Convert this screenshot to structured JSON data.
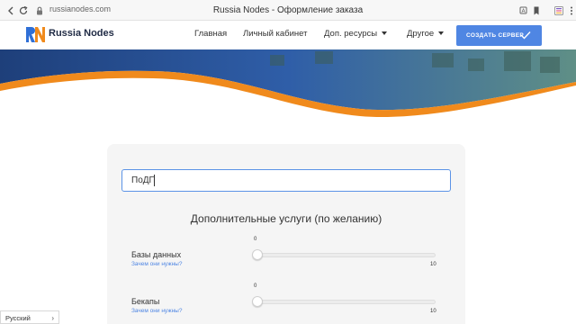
{
  "browser": {
    "url": "russianodes.com",
    "tab_title": "Russia Nodes - Оформление заказа"
  },
  "nav": {
    "brand": "Russia Nodes",
    "items": [
      {
        "label": "Главная",
        "dropdown": false
      },
      {
        "label": "Личный кабинет",
        "dropdown": false
      },
      {
        "label": "Доп. ресурсы",
        "dropdown": true
      },
      {
        "label": "Другое",
        "dropdown": true
      }
    ],
    "create_button": "СОЗДАТЬ СЕРВЕР"
  },
  "order": {
    "promo_value": "ПоДП",
    "section_title": "Дополнительные услуги (по желанию)",
    "options": [
      {
        "label": "Базы данных",
        "link": "Зачем они нужны?",
        "value": "0",
        "max": "10",
        "fraction": 0
      },
      {
        "label": "Бекапы",
        "link": "Зачем они нужны?",
        "value": "0",
        "max": "10",
        "fraction": 0
      }
    ]
  },
  "language": {
    "selected": "Русский"
  },
  "colors": {
    "accent": "#4f86e3",
    "hero_orange": "#f08a1c",
    "hero_blue": "#2f5ea8"
  },
  "icons": [
    "lock-icon",
    "logo-icon",
    "chevron-down-icon",
    "check-icon",
    "chevron-right-icon",
    "translate-icon",
    "bookmark-icon",
    "extension-icon",
    "menu-icon"
  ]
}
